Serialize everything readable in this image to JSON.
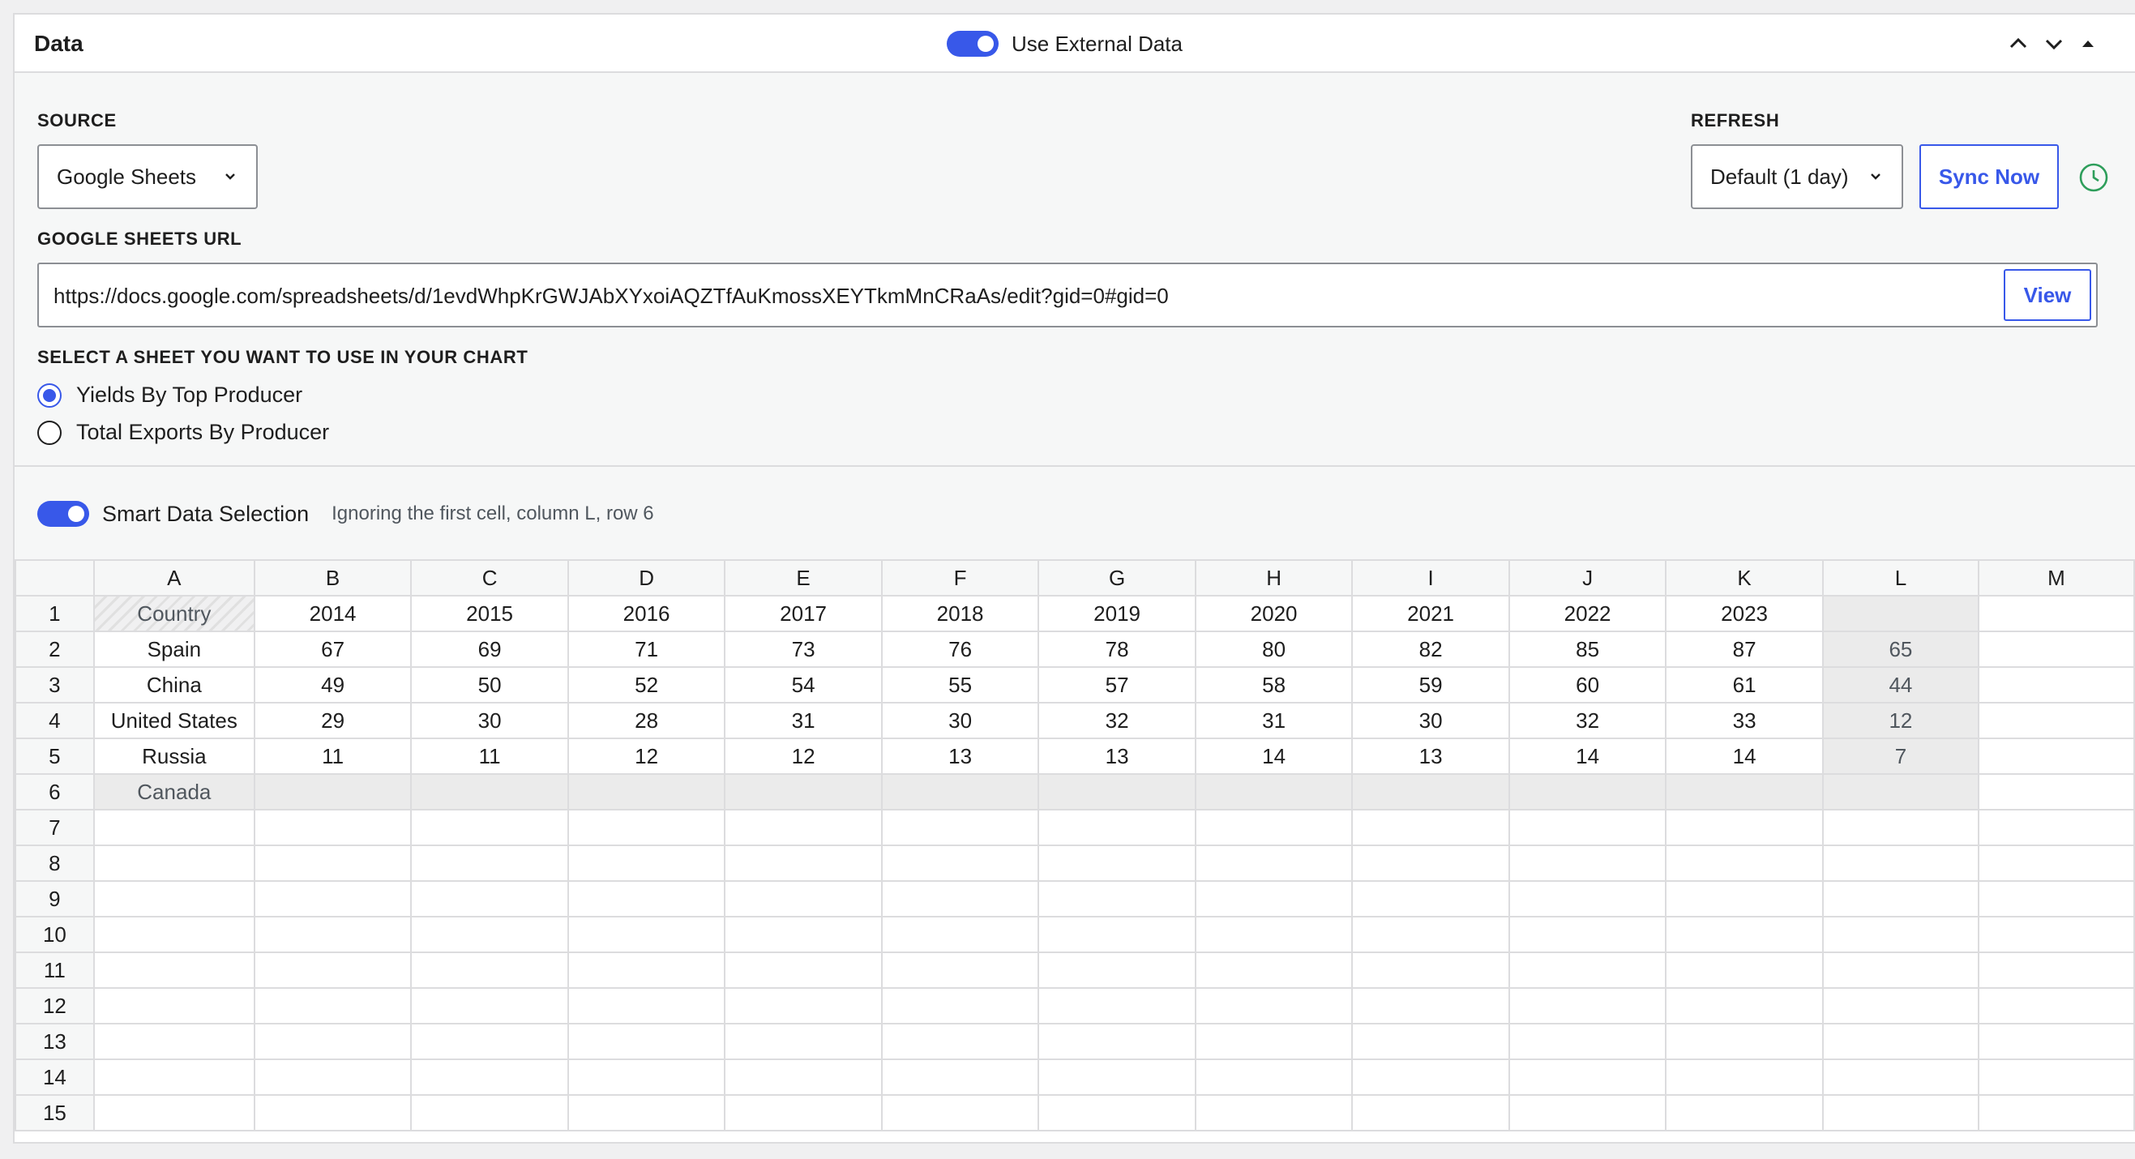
{
  "header": {
    "title": "Data",
    "external_toggle_label": "Use External Data"
  },
  "source": {
    "label": "SOURCE",
    "selected": "Google Sheets"
  },
  "refresh": {
    "label": "REFRESH",
    "selected": "Default (1 day)",
    "sync_label": "Sync Now"
  },
  "sheets_url": {
    "label": "GOOGLE SHEETS URL",
    "value": "https://docs.google.com/spreadsheets/d/1evdWhpKrGWJAbXYxoiAQZTfAuKmossXEYTkmMnCRaAs/edit?gid=0#gid=0",
    "view_label": "View"
  },
  "sheet_select": {
    "label": "SELECT A SHEET YOU WANT TO USE IN YOUR CHART",
    "options": [
      {
        "label": "Yields By Top Producer",
        "checked": true
      },
      {
        "label": "Total Exports By Producer",
        "checked": false
      }
    ]
  },
  "smart_selection": {
    "label": "Smart Data Selection",
    "note": "Ignoring the first cell, column L, row 6"
  },
  "grid": {
    "columns": [
      "A",
      "B",
      "C",
      "D",
      "E",
      "F",
      "G",
      "H",
      "I",
      "J",
      "K",
      "L",
      "M"
    ],
    "row_numbers": [
      "1",
      "2",
      "3",
      "4",
      "5",
      "6",
      "7",
      "8",
      "9",
      "10",
      "11",
      "12",
      "13",
      "14",
      "15"
    ],
    "rows": [
      [
        "Country",
        "2014",
        "2015",
        "2016",
        "2017",
        "2018",
        "2019",
        "2020",
        "2021",
        "2022",
        "2023",
        "",
        ""
      ],
      [
        "Spain",
        "67",
        "69",
        "71",
        "73",
        "76",
        "78",
        "80",
        "82",
        "85",
        "87",
        "65",
        ""
      ],
      [
        "China",
        "49",
        "50",
        "52",
        "54",
        "55",
        "57",
        "58",
        "59",
        "60",
        "61",
        "44",
        ""
      ],
      [
        "United States",
        "29",
        "30",
        "28",
        "31",
        "30",
        "32",
        "31",
        "30",
        "32",
        "33",
        "12",
        ""
      ],
      [
        "Russia",
        "11",
        "11",
        "12",
        "12",
        "13",
        "13",
        "14",
        "13",
        "14",
        "14",
        "7",
        ""
      ],
      [
        "Canada",
        "",
        "",
        "",
        "",
        "",
        "",
        "",
        "",
        "",
        "",
        "",
        ""
      ],
      [
        "",
        "",
        "",
        "",
        "",
        "",
        "",
        "",
        "",
        "",
        "",
        "",
        ""
      ],
      [
        "",
        "",
        "",
        "",
        "",
        "",
        "",
        "",
        "",
        "",
        "",
        "",
        ""
      ],
      [
        "",
        "",
        "",
        "",
        "",
        "",
        "",
        "",
        "",
        "",
        "",
        "",
        ""
      ],
      [
        "",
        "",
        "",
        "",
        "",
        "",
        "",
        "",
        "",
        "",
        "",
        "",
        ""
      ],
      [
        "",
        "",
        "",
        "",
        "",
        "",
        "",
        "",
        "",
        "",
        "",
        "",
        ""
      ],
      [
        "",
        "",
        "",
        "",
        "",
        "",
        "",
        "",
        "",
        "",
        "",
        "",
        ""
      ],
      [
        "",
        "",
        "",
        "",
        "",
        "",
        "",
        "",
        "",
        "",
        "",
        "",
        ""
      ],
      [
        "",
        "",
        "",
        "",
        "",
        "",
        "",
        "",
        "",
        "",
        "",
        "",
        ""
      ],
      [
        "",
        "",
        "",
        "",
        "",
        "",
        "",
        "",
        "",
        "",
        "",
        "",
        ""
      ]
    ],
    "ignored_column": "L",
    "ignored_row": "6"
  },
  "colors": {
    "accent": "#3858e9",
    "clock_icon": "#2e9e5b"
  }
}
